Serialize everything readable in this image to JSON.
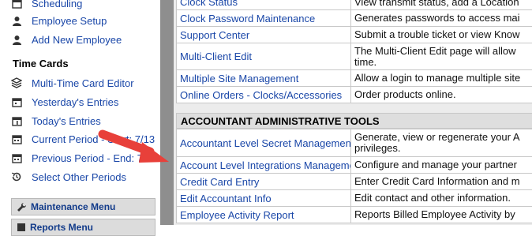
{
  "sidebar": {
    "top_items": [
      {
        "label": "Scheduling",
        "icon": "calendar-icon"
      },
      {
        "label": "Employee Setup",
        "icon": "person-icon"
      },
      {
        "label": "Add New Employee",
        "icon": "person-icon"
      }
    ],
    "time_cards_heading": "Time Cards",
    "time_card_items": [
      {
        "label": "Multi-Time Card Editor",
        "icon": "layers-icon"
      },
      {
        "label": "Yesterday's Entries",
        "icon": "calendar-icon"
      },
      {
        "label": "Today's Entries",
        "icon": "calendar-icon"
      },
      {
        "label": "Current Period - Start: 7/13",
        "icon": "calendar-icon"
      },
      {
        "label": "Previous Period - End: 7/",
        "icon": "calendar-icon"
      },
      {
        "label": "Select Other Periods",
        "icon": "history-icon"
      }
    ],
    "menus": [
      {
        "label": "Maintenance Menu",
        "icon": "wrench-icon"
      },
      {
        "label": "Reports Menu",
        "icon": "report-icon"
      }
    ]
  },
  "main": {
    "top_rows": [
      {
        "link": "Clock Status",
        "desc": "View transmit status, add a Location"
      },
      {
        "link": "Clock Password Maintenance",
        "desc": "Generates passwords to access mai"
      },
      {
        "link": "Support Center",
        "desc": "Submit a trouble ticket or view Know"
      },
      {
        "link": "Multi-Client Edit",
        "desc": "The Multi-Client Edit page will allow",
        "desc2": "time."
      },
      {
        "link": "Multiple Site Management",
        "desc": "Allow a login to manage multiple site"
      },
      {
        "link": "Online Orders - Clocks/Accessories",
        "desc": "Order products online."
      }
    ],
    "section_heading": "ACCOUNTANT ADMINISTRATIVE TOOLS",
    "section_rows": [
      {
        "link": "Accountant Level Secret Management",
        "desc": "Generate, view or regenerate your A",
        "desc2": "privileges."
      },
      {
        "link": "Account Level Integrations Management",
        "desc": "Configure and manage your partner"
      },
      {
        "link": "Credit Card Entry",
        "desc": "Enter Credit Card Information and m"
      },
      {
        "link": "Edit Accountant Info",
        "desc": "Edit contact and other information."
      },
      {
        "link": "Employee Activity Report",
        "desc": "Reports Billed Employee Activity by"
      }
    ]
  },
  "annotation": {
    "color": "#e8403a"
  }
}
